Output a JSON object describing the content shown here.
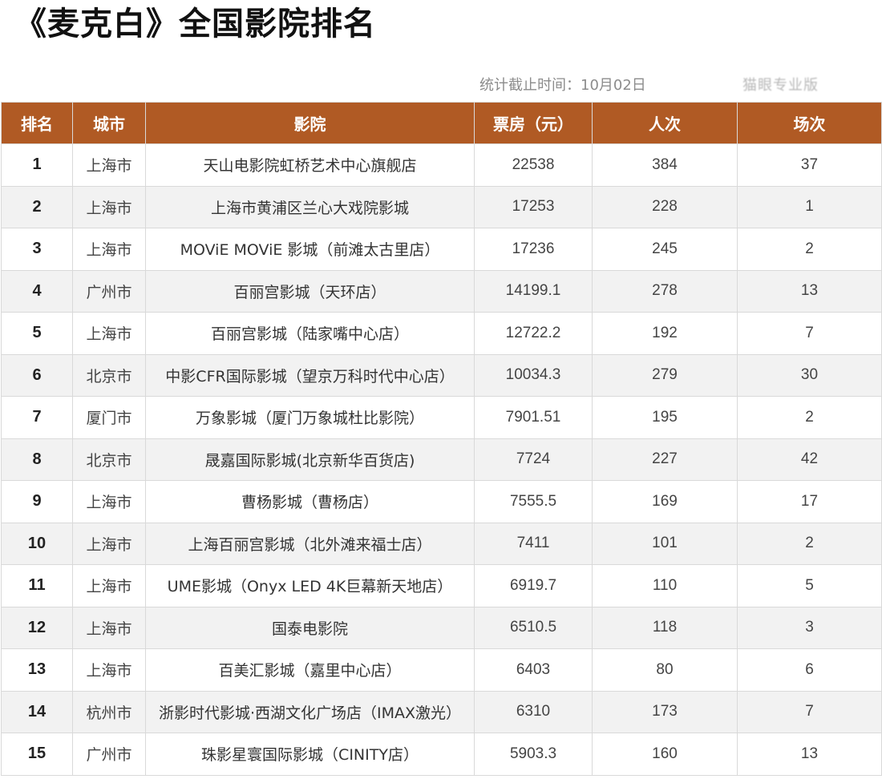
{
  "title": "《麦克白》全国影院排名",
  "stat_time": "统计截止时间：10月02日",
  "watermark": "猫眼专业版",
  "table": {
    "headers": [
      "排名",
      "城市",
      "影院",
      "票房（元）",
      "人次",
      "场次"
    ],
    "rows": [
      [
        "1",
        "上海市",
        "天山电影院虹桥艺术中心旗舰店",
        "22538",
        "384",
        "37"
      ],
      [
        "2",
        "上海市",
        "上海市黄浦区兰心大戏院影城",
        "17253",
        "228",
        "1"
      ],
      [
        "3",
        "上海市",
        "MOViE MOViE 影城（前滩太古里店）",
        "17236",
        "245",
        "2"
      ],
      [
        "4",
        "广州市",
        "百丽宫影城（天环店）",
        "14199.1",
        "278",
        "13"
      ],
      [
        "5",
        "上海市",
        "百丽宫影城（陆家嘴中心店）",
        "12722.2",
        "192",
        "7"
      ],
      [
        "6",
        "北京市",
        "中影CFR国际影城（望京万科时代中心店）",
        "10034.3",
        "279",
        "30"
      ],
      [
        "7",
        "厦门市",
        "万象影城（厦门万象城杜比影院）",
        "7901.51",
        "195",
        "2"
      ],
      [
        "8",
        "北京市",
        "晟嘉国际影城(北京新华百货店)",
        "7724",
        "227",
        "42"
      ],
      [
        "9",
        "上海市",
        "曹杨影城（曹杨店）",
        "7555.5",
        "169",
        "17"
      ],
      [
        "10",
        "上海市",
        "上海百丽宫影城（北外滩来福士店）",
        "7411",
        "101",
        "2"
      ],
      [
        "11",
        "上海市",
        "UME影城（Onyx LED 4K巨幕新天地店）",
        "6919.7",
        "110",
        "5"
      ],
      [
        "12",
        "上海市",
        "国泰电影院",
        "6510.5",
        "118",
        "3"
      ],
      [
        "13",
        "上海市",
        "百美汇影城（嘉里中心店）",
        "6403",
        "80",
        "6"
      ],
      [
        "14",
        "杭州市",
        "浙影时代影城·西湖文化广场店（IMAX激光）",
        "6310",
        "173",
        "7"
      ],
      [
        "15",
        "广州市",
        "珠影星寰国际影城（CINITY店）",
        "5903.3",
        "160",
        "13"
      ]
    ]
  },
  "colors": {
    "header_bg": "#b05a24",
    "header_text": "#ffffff",
    "stripe": "#f2f2f2",
    "border": "#d9d9d9"
  }
}
